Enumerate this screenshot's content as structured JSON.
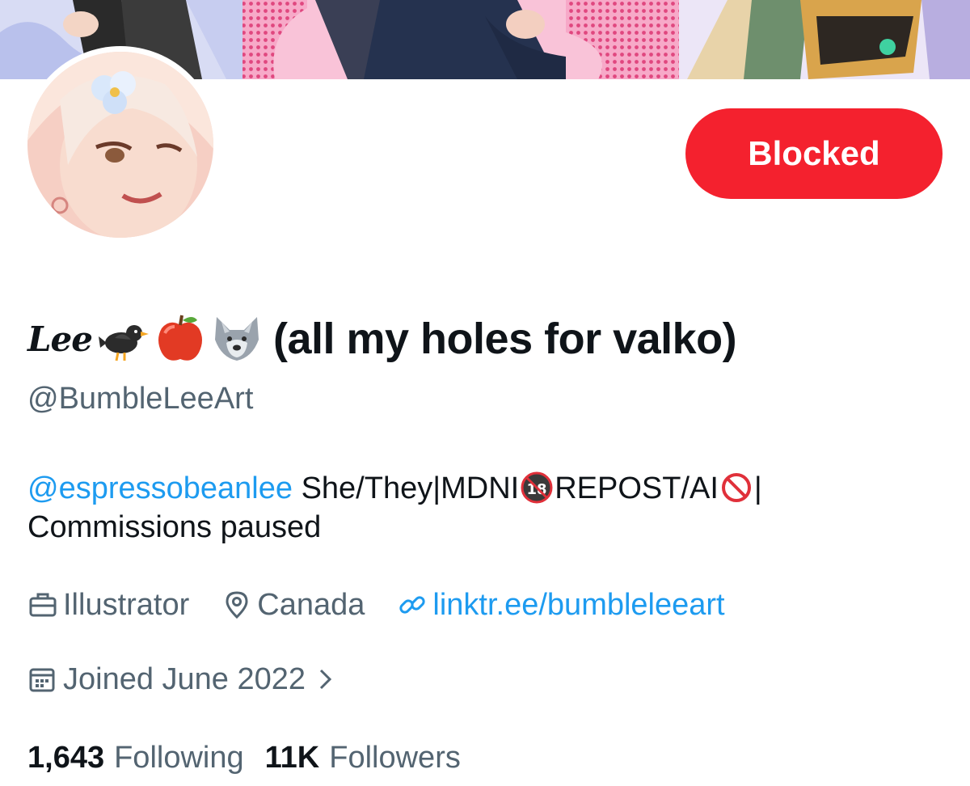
{
  "profile": {
    "display_name_script": "Lee",
    "display_name_emojis": [
      "bird-emoji",
      "apple-emoji",
      "wolf-emoji"
    ],
    "display_name_text": "(all my holes for valko)",
    "handle": "@BumbleLeeArt",
    "block_button_label": "Blocked",
    "accent_color": "#1d9bf0",
    "blocked_color": "#f4212e"
  },
  "bio": {
    "mention": "@espressobeanlee",
    "part1": " She/They|MDNI",
    "badge_under18": "under-18-icon",
    "part2": "REPOST/AI",
    "badge_prohibited": "prohibited-icon",
    "part3": "|",
    "line2": "Commissions paused"
  },
  "meta": {
    "profession": "Illustrator",
    "location": "Canada",
    "link": "linktr.ee/bumbleleeart",
    "joined": "Joined June 2022"
  },
  "stats": {
    "following_count": "1,643",
    "following_label": "Following",
    "followers_count": "11K",
    "followers_label": "Followers"
  }
}
